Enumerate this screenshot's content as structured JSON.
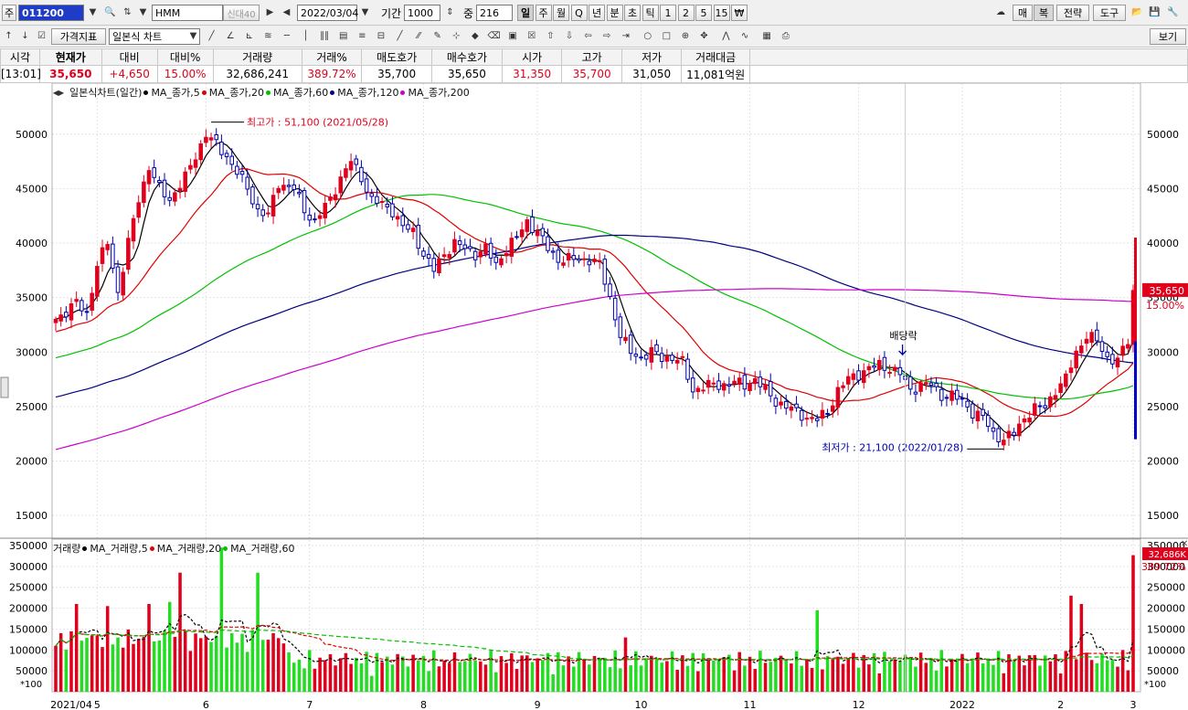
{
  "toolbar": {
    "mode_label": "주",
    "code": "011200",
    "name": "HMM",
    "badge_new": "신대40",
    "date": "2022/03/04",
    "period_label": "기간",
    "period_value": "1000",
    "count_label": "중",
    "count_value": "216",
    "timeframes": [
      "일",
      "주",
      "월",
      "Q",
      "년",
      "분",
      "초",
      "틱",
      "1",
      "2",
      "5",
      "15",
      "₩"
    ],
    "right_buttons": [
      "매",
      "복",
      "전략",
      "도구"
    ],
    "price_indicator": "가격지표",
    "chart_type": "일본식 차트",
    "view_button": "보기"
  },
  "quote": {
    "headers": [
      "시각",
      "현재가",
      "대비",
      "대비%",
      "거래량",
      "거래%",
      "매도호가",
      "매수호가",
      "시가",
      "고가",
      "저가",
      "거래대금"
    ],
    "values": [
      "[13:01]",
      "35,650",
      "+4,650",
      "15.00%",
      "32,686,241",
      "389.72%",
      "35,700",
      "35,650",
      "31,350",
      "35,700",
      "31,050",
      "11,081억원"
    ]
  },
  "legend": {
    "price_title": "일본식차트(일간)",
    "ma": [
      {
        "label": "MA_종가,5",
        "color": "#000000"
      },
      {
        "label": "MA_종가,20",
        "color": "#e00000"
      },
      {
        "label": "MA_종가,60",
        "color": "#00c000"
      },
      {
        "label": "MA_종가,120",
        "color": "#000080"
      },
      {
        "label": "MA_종가,200",
        "color": "#cc00cc"
      }
    ],
    "volume_title": "거래량",
    "vol_ma": [
      {
        "label": "MA_거래량,5",
        "color": "#000000"
      },
      {
        "label": "MA_거래량,20",
        "color": "#e00000"
      },
      {
        "label": "MA_거래량,60",
        "color": "#00c000"
      }
    ]
  },
  "annotations": {
    "high": "최고가 : 51,100 (2021/05/28)",
    "low": "최저가 : 21,100 (2022/01/28)",
    "dividend": "배당락",
    "price_box": "35,650",
    "pct_box": "15.00%",
    "vol_box": "32,686K",
    "vol_pct": "389.72%",
    "unit": "*100"
  },
  "colors": {
    "up": "#e0001c",
    "down": "#0000aa",
    "ma5": "#000000",
    "ma20": "#e00000",
    "ma60": "#00c000",
    "ma120": "#000080",
    "ma200": "#cc00cc",
    "vol_green": "#22dd22"
  },
  "chart_data": {
    "type": "candlestick",
    "ylim": [
      13000,
      53000
    ],
    "yticks": [
      15000,
      20000,
      25000,
      30000,
      35000,
      40000,
      45000,
      50000
    ],
    "vol_ylim": [
      0,
      350000
    ],
    "vol_ticks": [
      50000,
      100000,
      150000,
      200000,
      250000,
      300000,
      350000
    ],
    "x_labels": [
      "2021/04",
      "5",
      "6",
      "7",
      "8",
      "9",
      "10",
      "11",
      "12",
      "2022",
      "2",
      "3"
    ],
    "keypoints": [
      [
        0,
        33000
      ],
      [
        4,
        34500
      ],
      [
        6,
        33500
      ],
      [
        8,
        38000
      ],
      [
        10,
        40000
      ],
      [
        12,
        35500
      ],
      [
        14,
        40000
      ],
      [
        16,
        44000
      ],
      [
        18,
        47000
      ],
      [
        20,
        45000
      ],
      [
        22,
        44000
      ],
      [
        25,
        46000
      ],
      [
        27,
        48000
      ],
      [
        29,
        50000
      ],
      [
        31,
        49000
      ],
      [
        33,
        48000
      ],
      [
        35,
        46500
      ],
      [
        37,
        45000
      ],
      [
        39,
        43000
      ],
      [
        41,
        42500
      ],
      [
        43,
        45500
      ],
      [
        46,
        45000
      ],
      [
        48,
        43000
      ],
      [
        50,
        42000
      ],
      [
        53,
        44000
      ],
      [
        55,
        46000
      ],
      [
        57,
        47500
      ],
      [
        59,
        46000
      ],
      [
        61,
        44000
      ],
      [
        63,
        43500
      ],
      [
        65,
        43000
      ],
      [
        67,
        41500
      ],
      [
        69,
        41000
      ],
      [
        71,
        39000
      ],
      [
        73,
        37500
      ],
      [
        75,
        39000
      ],
      [
        77,
        40000
      ],
      [
        79,
        39500
      ],
      [
        81,
        39000
      ],
      [
        83,
        39500
      ],
      [
        85,
        38000
      ],
      [
        87,
        39500
      ],
      [
        89,
        40500
      ],
      [
        91,
        42000
      ],
      [
        93,
        41000
      ],
      [
        95,
        39500
      ],
      [
        97,
        38500
      ],
      [
        99,
        38500
      ],
      [
        101,
        38500
      ],
      [
        103,
        38500
      ],
      [
        105,
        38000
      ],
      [
        107,
        35000
      ],
      [
        109,
        31500
      ],
      [
        111,
        30000
      ],
      [
        113,
        29500
      ],
      [
        115,
        30000
      ],
      [
        117,
        29500
      ],
      [
        119,
        29500
      ],
      [
        121,
        29000
      ],
      [
        123,
        26500
      ],
      [
        125,
        26800
      ],
      [
        127,
        27000
      ],
      [
        129,
        27000
      ],
      [
        131,
        27200
      ],
      [
        133,
        27000
      ],
      [
        135,
        27500
      ],
      [
        137,
        26500
      ],
      [
        139,
        25500
      ],
      [
        141,
        25000
      ],
      [
        143,
        24500
      ],
      [
        145,
        24000
      ],
      [
        147,
        23800
      ],
      [
        149,
        24500
      ],
      [
        151,
        26500
      ],
      [
        153,
        27500
      ],
      [
        155,
        28000
      ],
      [
        157,
        28500
      ],
      [
        159,
        28800
      ],
      [
        161,
        28500
      ],
      [
        163,
        28000
      ],
      [
        165,
        26500
      ],
      [
        167,
        27000
      ],
      [
        169,
        27000
      ],
      [
        171,
        26000
      ],
      [
        173,
        26000
      ],
      [
        175,
        25500
      ],
      [
        177,
        24500
      ],
      [
        179,
        24000
      ],
      [
        181,
        22500
      ],
      [
        183,
        22000
      ],
      [
        185,
        22500
      ],
      [
        187,
        24000
      ],
      [
        189,
        24800
      ],
      [
        191,
        25000
      ],
      [
        193,
        26500
      ],
      [
        195,
        27500
      ],
      [
        197,
        30000
      ],
      [
        199,
        31500
      ],
      [
        201,
        31000
      ],
      [
        203,
        29500
      ],
      [
        205,
        29200
      ],
      [
        207,
        31000
      ],
      [
        208,
        35650
      ]
    ],
    "high_point": {
      "index": 30,
      "value": 51100
    },
    "low_point": {
      "index": 183,
      "value": 21100
    },
    "volume_spikes": [
      {
        "index": 4,
        "value": 210000
      },
      {
        "index": 10,
        "value": 205000
      },
      {
        "index": 18,
        "value": 210000
      },
      {
        "index": 22,
        "value": 215000
      },
      {
        "index": 24,
        "value": 285000
      },
      {
        "index": 32,
        "value": 345000
      },
      {
        "index": 39,
        "value": 285000
      },
      {
        "index": 110,
        "value": 130000
      },
      {
        "index": 147,
        "value": 195000
      },
      {
        "index": 196,
        "value": 230000
      },
      {
        "index": 198,
        "value": 210000
      },
      {
        "index": 208,
        "value": 326860
      }
    ]
  }
}
